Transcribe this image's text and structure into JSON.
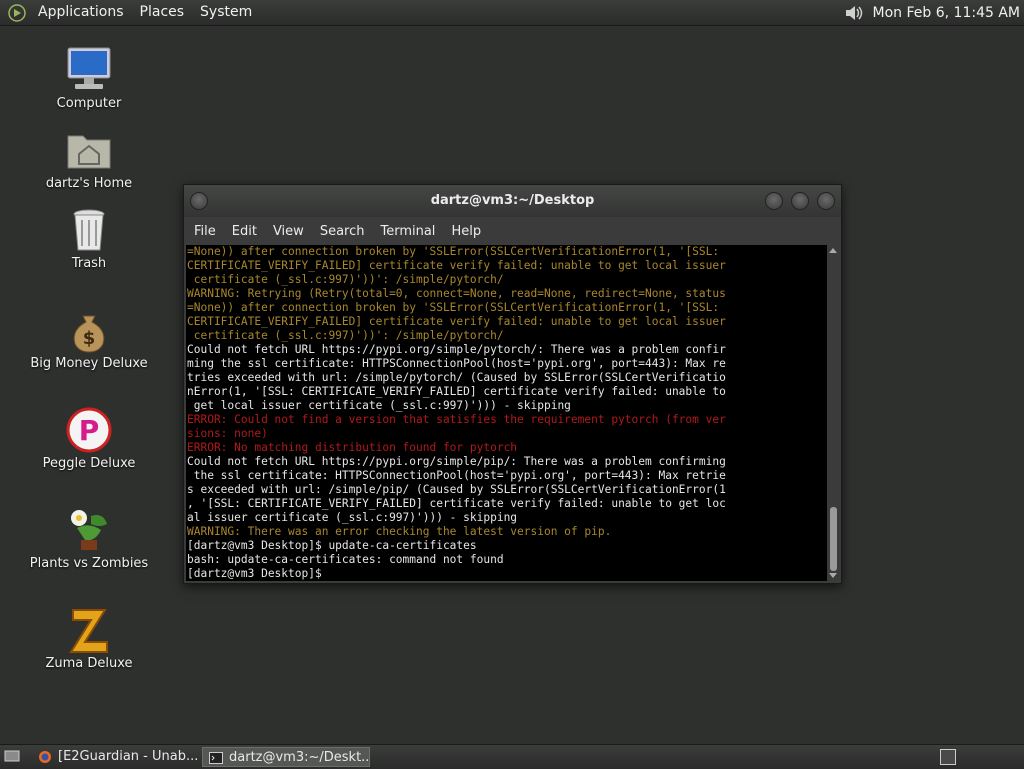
{
  "top_panel": {
    "menus": [
      "Applications",
      "Places",
      "System"
    ],
    "clock": "Mon Feb  6, 11:45 AM"
  },
  "desktop_icons": [
    {
      "label": "Computer",
      "icon": "computer-icon"
    },
    {
      "label": "dartz's Home",
      "icon": "home-folder-icon"
    },
    {
      "label": "Trash",
      "icon": "trash-icon"
    },
    {
      "label": "Big Money Deluxe",
      "icon": "money-bag-icon"
    },
    {
      "label": "Peggle Deluxe",
      "icon": "peggle-icon"
    },
    {
      "label": "Plants vs Zombies",
      "icon": "plants-vs-zombies-icon"
    },
    {
      "label": "Zuma Deluxe",
      "icon": "zuma-icon"
    }
  ],
  "terminal": {
    "title": "dartz@vm3:~/Desktop",
    "menu": [
      "File",
      "Edit",
      "View",
      "Search",
      "Terminal",
      "Help"
    ],
    "lines": [
      {
        "t": "=None)) after connection broken by 'SSLError(SSLCertVerificationError(1, '[SSL:",
        "c": "y"
      },
      {
        "t": "CERTIFICATE_VERIFY_FAILED] certificate verify failed: unable to get local issuer",
        "c": "y"
      },
      {
        "t": " certificate (_ssl.c:997)'))': /simple/pytorch/",
        "c": "y"
      },
      {
        "t": "WARNING: Retrying (Retry(total=0, connect=None, read=None, redirect=None, status",
        "c": "y"
      },
      {
        "t": "=None)) after connection broken by 'SSLError(SSLCertVerificationError(1, '[SSL:",
        "c": "y"
      },
      {
        "t": "CERTIFICATE_VERIFY_FAILED] certificate verify failed: unable to get local issuer",
        "c": "y"
      },
      {
        "t": " certificate (_ssl.c:997)'))': /simple/pytorch/",
        "c": "y"
      },
      {
        "t": "Could not fetch URL https://pypi.org/simple/pytorch/: There was a problem confir",
        "c": "w"
      },
      {
        "t": "ming the ssl certificate: HTTPSConnectionPool(host='pypi.org', port=443): Max re",
        "c": "w"
      },
      {
        "t": "tries exceeded with url: /simple/pytorch/ (Caused by SSLError(SSLCertVerificatio",
        "c": "w"
      },
      {
        "t": "nError(1, '[SSL: CERTIFICATE_VERIFY_FAILED] certificate verify failed: unable to",
        "c": "w"
      },
      {
        "t": " get local issuer certificate (_ssl.c:997)'))) - skipping",
        "c": "w"
      },
      {
        "t": "ERROR: Could not find a version that satisfies the requirement pytorch (from ver",
        "c": "r"
      },
      {
        "t": "sions: none)",
        "c": "r"
      },
      {
        "t": "ERROR: No matching distribution found for pytorch",
        "c": "r"
      },
      {
        "t": "Could not fetch URL https://pypi.org/simple/pip/: There was a problem confirming",
        "c": "w"
      },
      {
        "t": " the ssl certificate: HTTPSConnectionPool(host='pypi.org', port=443): Max retrie",
        "c": "w"
      },
      {
        "t": "s exceeded with url: /simple/pip/ (Caused by SSLError(SSLCertVerificationError(1",
        "c": "w"
      },
      {
        "t": ", '[SSL: CERTIFICATE_VERIFY_FAILED] certificate verify failed: unable to get loc",
        "c": "w"
      },
      {
        "t": "al issuer certificate (_ssl.c:997)'))) - skipping",
        "c": "w"
      },
      {
        "t": "WARNING: There was an error checking the latest version of pip.",
        "c": "y"
      },
      {
        "t": "[dartz@vm3 Desktop]$ update-ca-certificates",
        "c": "w"
      },
      {
        "t": "bash: update-ca-certificates: command not found",
        "c": "w"
      },
      {
        "t": "[dartz@vm3 Desktop]$ ",
        "c": "w"
      }
    ]
  },
  "taskbar": {
    "tasks": [
      {
        "label": "[E2Guardian - Unab...",
        "icon": "firefox-icon",
        "active": false
      },
      {
        "label": "dartz@vm3:~/Deskt...",
        "icon": "terminal-icon",
        "active": true
      }
    ]
  },
  "colors": {
    "warning": "#a8872c",
    "error": "#b01a1a",
    "normal": "#e6e6e6",
    "desktop_bg": "#2e302e"
  }
}
